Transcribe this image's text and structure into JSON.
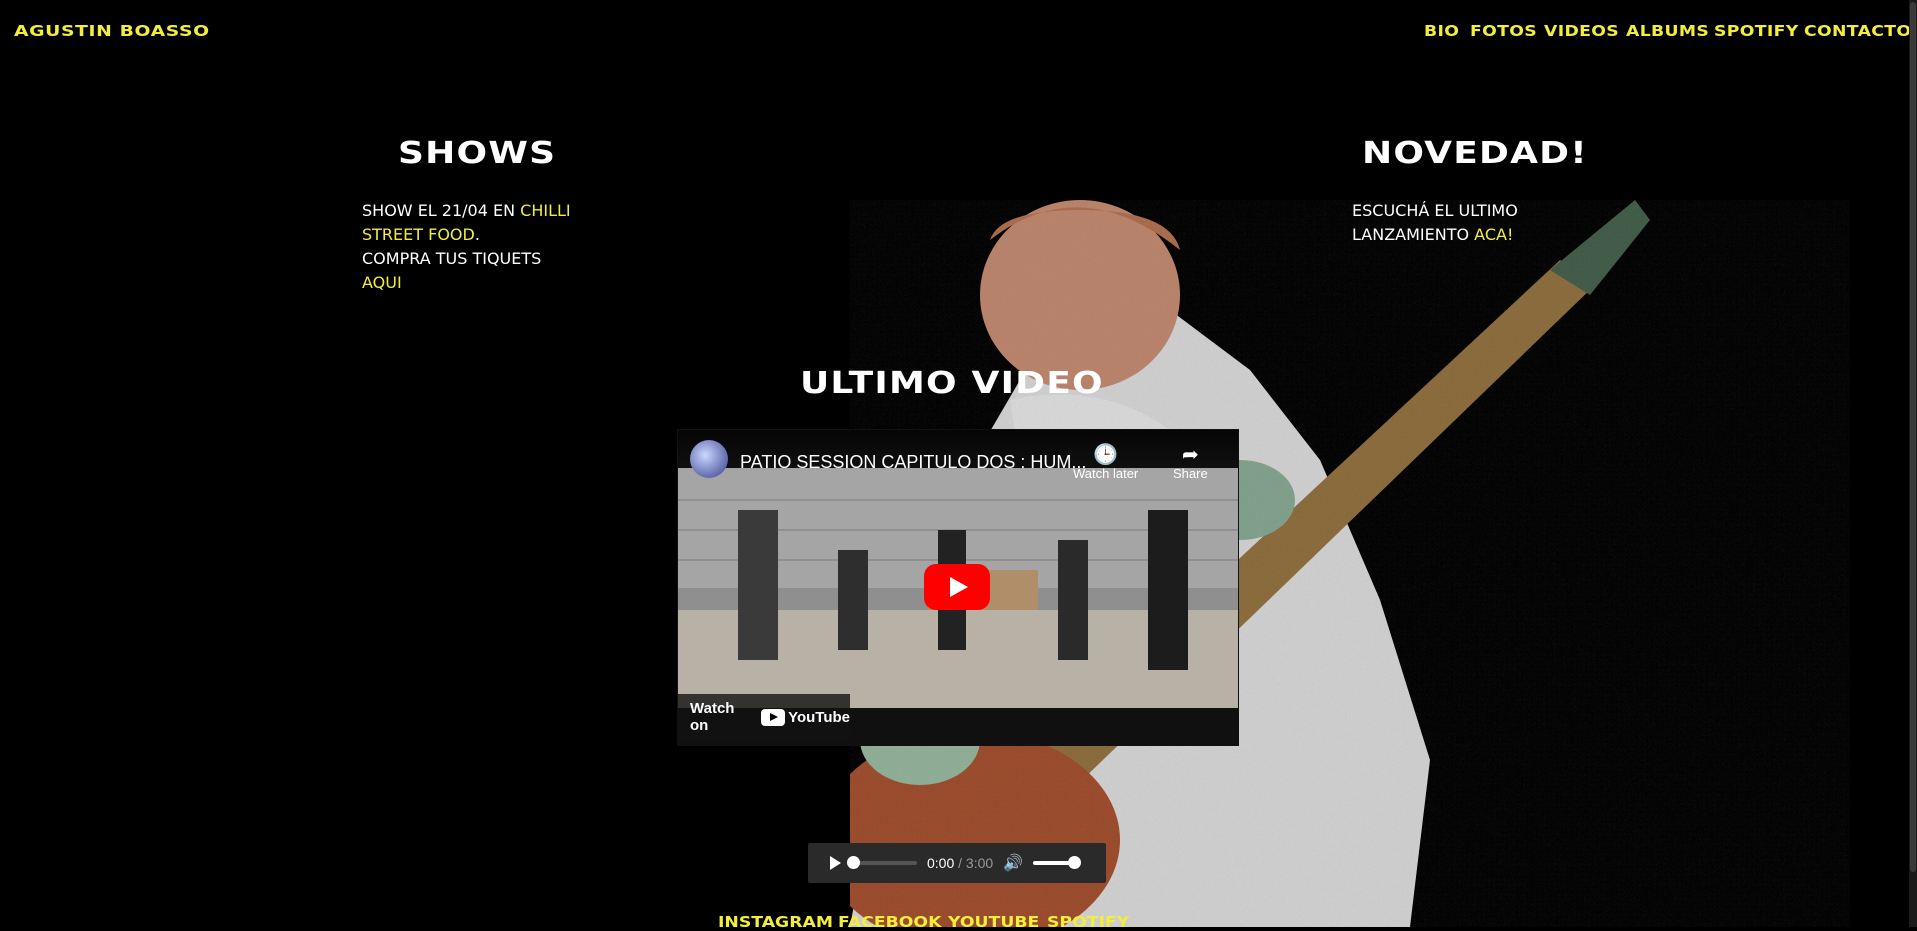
{
  "header": {
    "logo": "AGUSTIN BOASSO",
    "nav": [
      "BIO",
      "FOTOS",
      "VIDEOS",
      "ALBUMS",
      "SPOTIFY",
      "CONTACTO"
    ]
  },
  "shows": {
    "title": "SHOWS",
    "line1_a": "SHOW EL 21/04 EN ",
    "line1_link_a": "CHILLI",
    "line1_link_b": "STREET FOOD",
    "line1_b": ".",
    "line2": "COMPRA TUS TIQUETS ",
    "line2_link": "AQUI"
  },
  "novedad": {
    "title": "NOVEDAD!",
    "line1": "ESCUCHÁ EL ULTIMO",
    "line2": "LANZAMIENTO ",
    "line2_link": "ACA!"
  },
  "video": {
    "section_title": "ULTIMO VIDEO",
    "title": "PATIO SESSION CAPITULO DOS : HUM...",
    "watch_later": "Watch later",
    "share": "Share",
    "watch_on": "Watch on",
    "yt_brand": "YouTube",
    "icons": [
      "clock-icon",
      "share-arrow-icon",
      "youtube-play-icon"
    ]
  },
  "audio": {
    "current_time": "0:00",
    "separator": " / ",
    "duration": "3:00",
    "volume": 1.0
  },
  "footer": {
    "links": [
      "INSTAGRAM",
      "FACEBOOK",
      "YOUTUBE",
      "SPOTIFY"
    ]
  },
  "colors": {
    "accent": "#f2ee3b",
    "background": "#000000",
    "youtube_red": "#ff0000"
  }
}
